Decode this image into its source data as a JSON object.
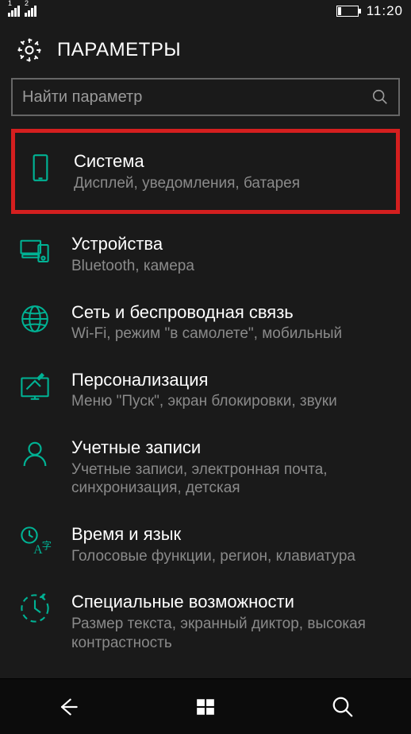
{
  "statusbar": {
    "sim1": "1",
    "sim2": "2",
    "clock": "11:20"
  },
  "header": {
    "title": "ПАРАМЕТРЫ"
  },
  "search": {
    "placeholder": "Найти параметр"
  },
  "items": [
    {
      "title": "Система",
      "sub": "Дисплей, уведомления, батарея",
      "icon": "device",
      "highlight": true
    },
    {
      "title": "Устройства",
      "sub": "Bluetooth, камера",
      "icon": "devices",
      "highlight": false
    },
    {
      "title": "Сеть и беспроводная связь",
      "sub": "Wi-Fi, режим \"в самолете\", мобильный",
      "icon": "globe",
      "highlight": false
    },
    {
      "title": "Персонализация",
      "sub": "Меню \"Пуск\", экран блокировки, звуки",
      "icon": "personalize",
      "highlight": false
    },
    {
      "title": "Учетные записи",
      "sub": "Учетные записи, электронная почта, синхронизация, детская",
      "icon": "account",
      "highlight": false
    },
    {
      "title": "Время и язык",
      "sub": "Голосовые функции, регион, клавиатура",
      "icon": "time-language",
      "highlight": false
    },
    {
      "title": "Специальные возможности",
      "sub": "Размер текста, экранный диктор, высокая контрастность",
      "icon": "accessibility",
      "highlight": false
    }
  ]
}
